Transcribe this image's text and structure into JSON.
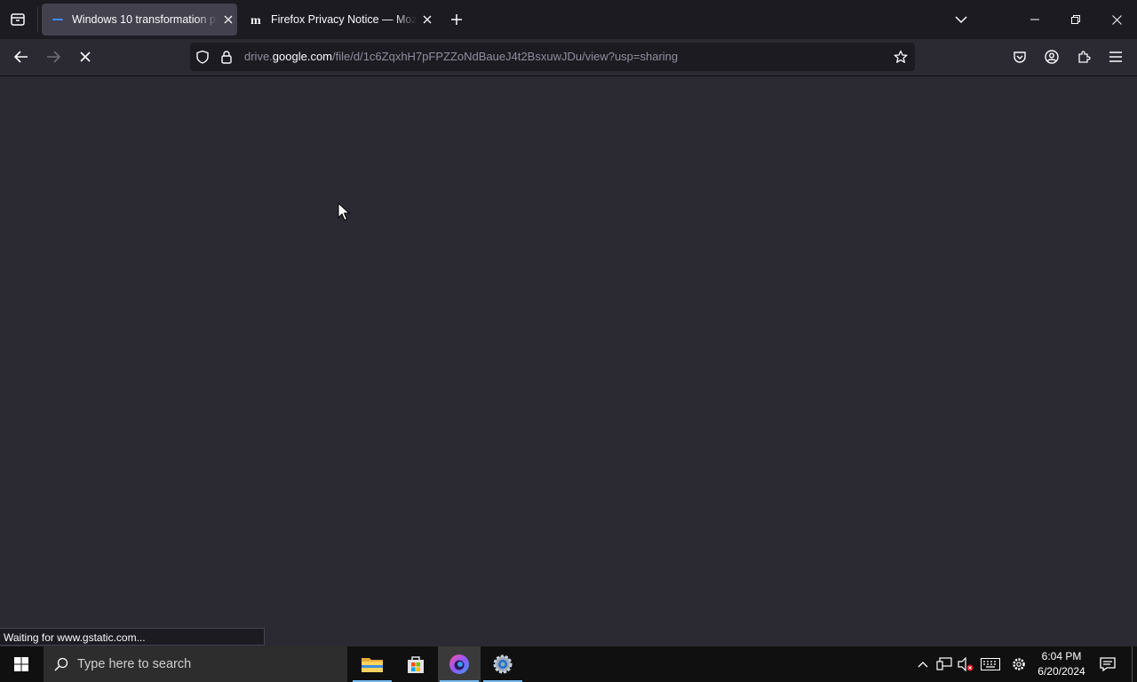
{
  "browser": {
    "tabs": [
      {
        "title": "Windows 10 transformation pack",
        "favicon": "drive-loading-icon",
        "active": true
      },
      {
        "title": "Firefox Privacy Notice — Mozilla",
        "favicon": "mozilla-m-icon",
        "active": false
      }
    ],
    "url": {
      "prefix": "drive.",
      "domain": "google.com",
      "path": "/file/d/1c6ZqxhH7pFPZZoNdBaueJ4t2BsxuwJDu/view?usp=sharing"
    },
    "status_text": "Waiting for www.gstatic.com..."
  },
  "taskbar": {
    "search_placeholder": "Type here to search",
    "apps": [
      "file-explorer-icon",
      "microsoft-store-icon",
      "firefox-icon",
      "settings-gear-icon"
    ],
    "time": "6:04 PM",
    "date": "6/20/2024"
  },
  "colors": {
    "tabstrip": "#1c1b22",
    "toolbar": "#2b2a33",
    "taskbar": "#101010",
    "accent": "#76b9ed"
  }
}
